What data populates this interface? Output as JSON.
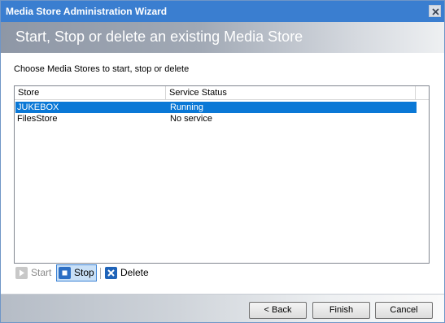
{
  "window": {
    "title": "Media Store Administration Wizard"
  },
  "banner": {
    "heading": "Start, Stop or delete an existing Media Store"
  },
  "prompt": "Choose Media Stores to start, stop or delete",
  "table": {
    "columns": [
      "Store",
      "Service Status"
    ],
    "rows": [
      {
        "store": "JUKEBOX",
        "status": "Running",
        "selected": true
      },
      {
        "store": "FilesStore",
        "status": "No service",
        "selected": false
      }
    ]
  },
  "toolbar": {
    "start_label": "Start",
    "stop_label": "Stop",
    "delete_label": "Delete"
  },
  "footer": {
    "back_label": "< Back",
    "finish_label": "Finish",
    "cancel_label": "Cancel"
  },
  "colors": {
    "titlebar": "#3a7ed0",
    "selection": "#0a78d6"
  },
  "icons": {
    "close": "close-icon",
    "start": "play-icon",
    "stop": "stop-icon",
    "delete": "delete-x-icon"
  }
}
